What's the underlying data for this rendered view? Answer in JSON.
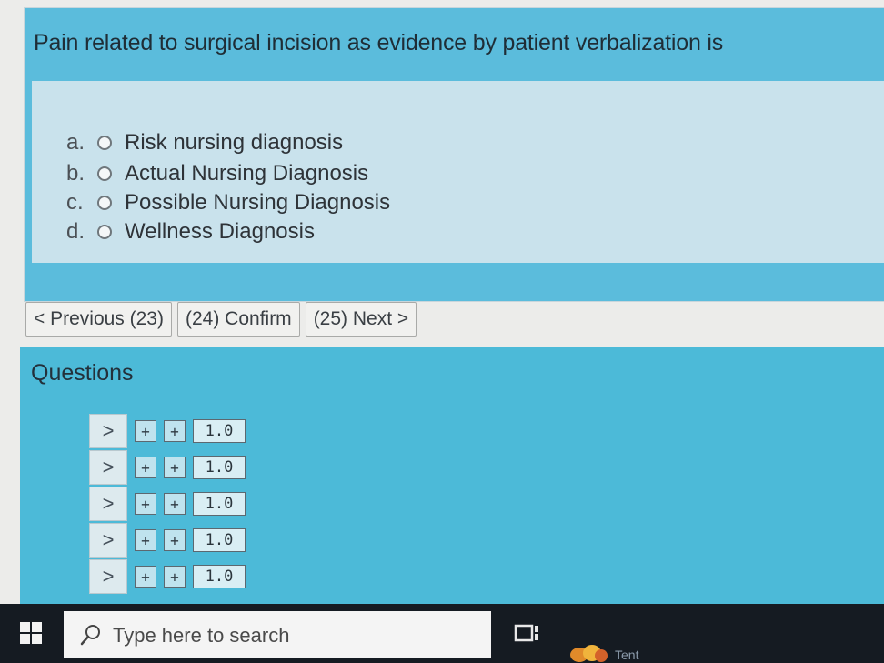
{
  "question": {
    "text": "Pain related to surgical incision as evidence by patient verbalization is",
    "options": [
      {
        "letter": "a.",
        "label": "Risk nursing diagnosis"
      },
      {
        "letter": "b.",
        "label": "Actual Nursing Diagnosis"
      },
      {
        "letter": "c.",
        "label": "Possible Nursing Diagnosis"
      },
      {
        "letter": "d.",
        "label": "Wellness Diagnosis"
      }
    ]
  },
  "nav": {
    "previous_label": "< Previous (23)",
    "confirm_label": "(24) Confirm",
    "next_label": "(25) Next >"
  },
  "questions_panel": {
    "title": "Questions",
    "rows": [
      {
        "chevron": ">",
        "plus1": "+",
        "plus2": "+",
        "value": "1.0"
      },
      {
        "chevron": ">",
        "plus1": "+",
        "plus2": "+",
        "value": "1.0"
      },
      {
        "chevron": ">",
        "plus1": "+",
        "plus2": "+",
        "value": "1.0"
      },
      {
        "chevron": ">",
        "plus1": "+",
        "plus2": "+",
        "value": "1.0"
      },
      {
        "chevron": ">",
        "plus1": "+",
        "plus2": "+",
        "value": "1.0"
      }
    ]
  },
  "taskbar": {
    "search_placeholder": "Type here to search",
    "tray_label": "Tent",
    "icons": [
      "windows-start-icon",
      "search-icon",
      "task-view-icon",
      "tray-app-icon"
    ]
  },
  "colors": {
    "card_blue": "#5bbcdc",
    "options_bg": "#c9e2ec",
    "questions_bg": "#4cbad8",
    "taskbar_bg": "#151b22"
  }
}
